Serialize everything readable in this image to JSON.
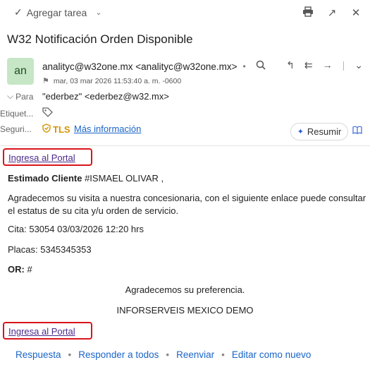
{
  "toolbar": {
    "add_task_label": "Agregar tarea",
    "icons": [
      "check-icon",
      "chevron-down-icon",
      "print-icon",
      "popout-icon",
      "close-icon"
    ]
  },
  "email": {
    "subject": "W32 Notificación Orden Disponible",
    "avatar_initials": "an",
    "sender": "analityc@w32one.mx <analityc@w32one.mx>",
    "date": "mar, 03 mar 2026 11:53:40 a. m. -0600",
    "to_label": "Para",
    "to_value": "\"ederbez\" <ederbez@w32.mx>",
    "tags_label": "Etiquet...",
    "security_label": "Seguri...",
    "tls_label": "TLS",
    "more_info_label": "Más información",
    "summarize_label": "Resumir"
  },
  "body": {
    "portal_link": "Ingresa al Portal",
    "greeting_bold": "Estimado Cliente",
    "greeting_rest": " #ISMAEL OLIVAR ,",
    "paragraph": "Agradecemos su visita a nuestra concesionaria, con el siguiente enlace puede consultar el estatus de su cita y/u orden de servicio.",
    "cita": "Cita: 53054 03/03/2026 12:20 hrs",
    "placas": "Placas: 5345345353",
    "or_label": "OR:",
    "or_value": " #",
    "thanks": "Agradecemos su preferencia.",
    "company": "INFORSERVEIS MEXICO DEMO"
  },
  "footer": {
    "reply": "Respuesta",
    "reply_all": "Responder a todos",
    "forward": "Reenviar",
    "edit_as_new": "Editar como nuevo"
  },
  "colors": {
    "link": "#1a64c8",
    "highlight_border": "#d9141b",
    "avatar_bg": "#c6e6c6",
    "tls": "#d69400"
  }
}
